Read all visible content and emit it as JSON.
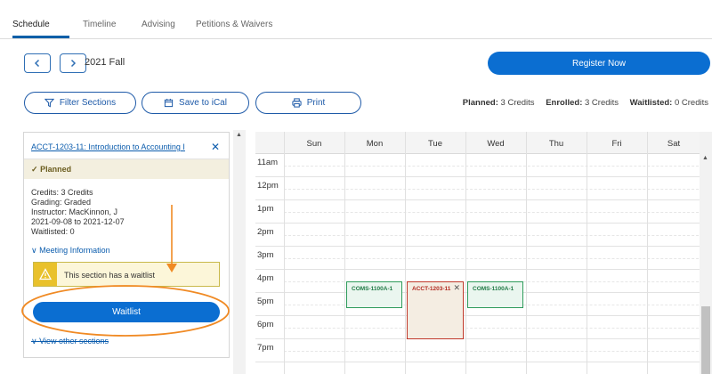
{
  "tabs": [
    {
      "label": "Schedule"
    },
    {
      "label": "Timeline"
    },
    {
      "label": "Advising"
    },
    {
      "label": "Petitions & Waivers"
    }
  ],
  "nav": {
    "term": "2021 Fall",
    "register_label": "Register Now"
  },
  "actions": {
    "filter_label": "Filter Sections",
    "ical_label": "Save to iCal",
    "print_label": "Print"
  },
  "credits": {
    "planned_label": "Planned:",
    "planned_value": "3 Credits",
    "enrolled_label": "Enrolled:",
    "enrolled_value": "3 Credits",
    "waitlisted_label": "Waitlisted:",
    "waitlisted_value": "0 Credits"
  },
  "section": {
    "title": "ACCT-1203-11: Introduction to Accounting I",
    "status": "Planned",
    "details": [
      "Credits: 3 Credits",
      "Grading: Graded",
      "Instructor: MacKinnon, J",
      "2021-09-08 to 2021-12-07",
      "Waitlisted:  0"
    ],
    "meeting_label": "Meeting Information",
    "warning": "This section has a waitlist",
    "waitlist_label": "Waitlist",
    "view_other_label": "View other sections"
  },
  "calendar": {
    "days": [
      "Sun",
      "Mon",
      "Tue",
      "Wed",
      "Thu",
      "Fri",
      "Sat"
    ],
    "hours": [
      "11am",
      "12pm",
      "1pm",
      "2pm",
      "3pm",
      "4pm",
      "5pm",
      "6pm",
      "7pm"
    ],
    "events": [
      {
        "code": "COMS-1100A-1",
        "day": "Mon",
        "color": "#2e9b5b"
      },
      {
        "code": "ACCT-1203-11",
        "day": "Tue",
        "color": "#c0392b"
      },
      {
        "code": "COMS-1100A-1",
        "day": "Wed",
        "color": "#2e9b5b"
      }
    ]
  },
  "colors": {
    "primary": "#0b6ed1",
    "annotation": "#f08a24"
  },
  "icons": [
    "chevron-left-icon",
    "chevron-right-icon",
    "filter-icon",
    "calendar-icon",
    "print-icon",
    "close-icon",
    "check-icon",
    "chevron-down-icon",
    "warning-icon"
  ]
}
